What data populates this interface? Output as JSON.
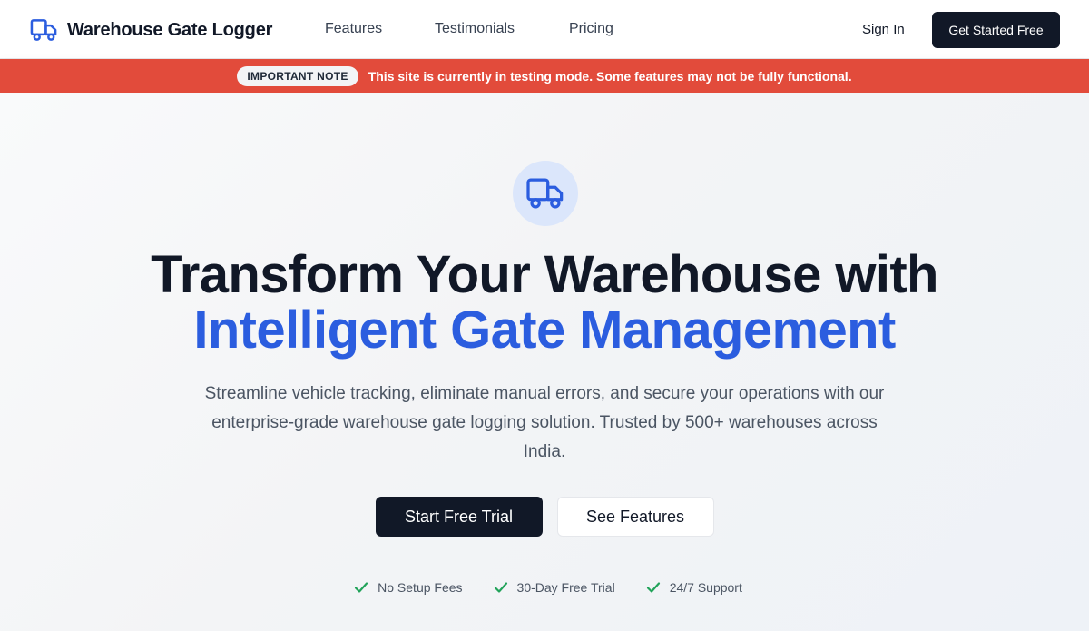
{
  "header": {
    "brand_name": "Warehouse Gate Logger",
    "brand_icon": "truck-icon",
    "nav": [
      {
        "label": "Features"
      },
      {
        "label": "Testimonials"
      },
      {
        "label": "Pricing"
      }
    ],
    "sign_in_label": "Sign In",
    "cta_label": "Get Started Free"
  },
  "banner": {
    "badge": "IMPORTANT NOTE",
    "message": "This site is currently in testing mode. Some features may not be fully functional.",
    "color": "#e24b3b"
  },
  "hero": {
    "icon": "truck-icon",
    "headline_line1": "Transform Your Warehouse with",
    "headline_line2": "Intelligent Gate Management",
    "subtext": "Streamline vehicle tracking, eliminate manual errors, and secure your operations with our enterprise-grade warehouse gate logging solution. Trusted by 500+ warehouses across India.",
    "primary_cta": "Start Free Trial",
    "secondary_cta": "See Features",
    "perks": [
      {
        "icon": "check-icon",
        "label": "No Setup Fees"
      },
      {
        "icon": "check-icon",
        "label": "30-Day Free Trial"
      },
      {
        "icon": "check-icon",
        "label": "24/7 Support"
      }
    ]
  },
  "colors": {
    "accent_blue": "#2b5ddf",
    "dark": "#111827",
    "check_green": "#22a35a",
    "icon_circle": "#dbe6fb"
  }
}
